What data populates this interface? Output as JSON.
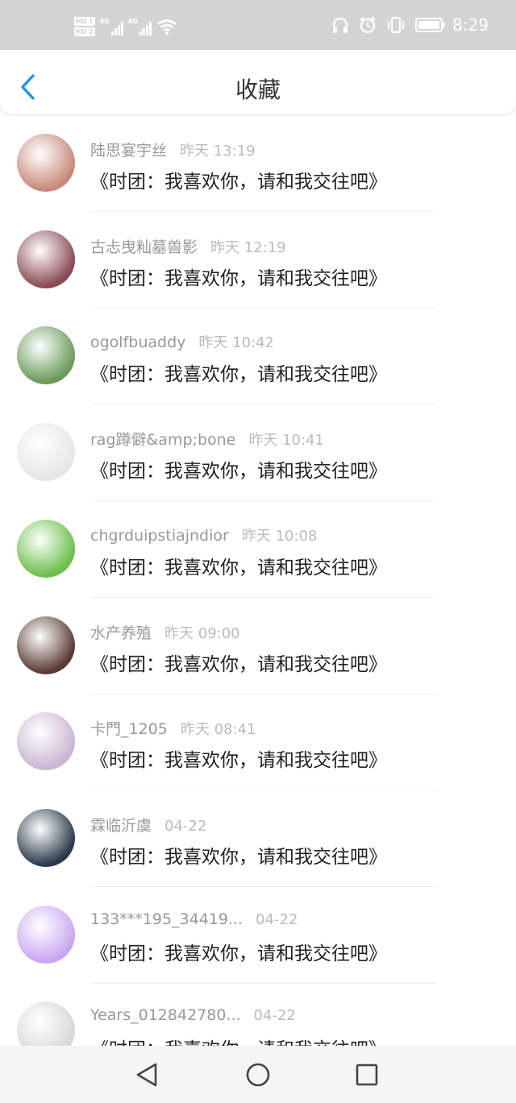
{
  "status_bar": {
    "time": "8:29",
    "sim1": "HD 1",
    "sim2": "HD 2",
    "net": "4G"
  },
  "header": {
    "title": "收藏",
    "back_icon": "chevron-left-icon"
  },
  "favorites": [
    {
      "name": "陆思宴宇丝",
      "time": "昨天 13:19",
      "message": "《时团：我喜欢你，请和我交往吧》",
      "avatar_color": "#c78a7a"
    },
    {
      "name": "古忐曳籼墓兽影",
      "time": "昨天 12:19",
      "message": "《时团：我喜欢你，请和我交往吧》",
      "avatar_color": "#8a4a54"
    },
    {
      "name": "ogolfbuaddy",
      "time": "昨天 10:42",
      "message": "《时团：我喜欢你，请和我交往吧》",
      "avatar_color": "#6a9a5a"
    },
    {
      "name": "rag蹲僻&amp;bone",
      "time": "昨天 10:41",
      "message": "《时团：我喜欢你，请和我交往吧》",
      "avatar_color": "#e6e6e6"
    },
    {
      "name": "chgrduipstiajndior",
      "time": "昨天 10:08",
      "message": "《时团：我喜欢你，请和我交往吧》",
      "avatar_color": "#6cbf4a"
    },
    {
      "name": "水产养殖",
      "time": "昨天 09:00",
      "message": "《时团：我喜欢你，请和我交往吧》",
      "avatar_color": "#5a3a32"
    },
    {
      "name": "卡門_1205",
      "time": "昨天 08:41",
      "message": "《时团：我喜欢你，请和我交往吧》",
      "avatar_color": "#c9b6d2"
    },
    {
      "name": "霖临沂虞",
      "time": "04-22",
      "message": "《时团：我喜欢你，请和我交往吧》",
      "avatar_color": "#2a3a4a"
    },
    {
      "name": "133***195_34419...",
      "time": "04-22",
      "message": "《时团：我喜欢你，请和我交往吧》",
      "avatar_color": "#c9a6f2"
    },
    {
      "name": "Years_012842780...",
      "time": "04-22",
      "message": "《时团：我喜欢你，请和我交往吧》",
      "avatar_color": "#d8d8d8"
    }
  ],
  "nav_bar": {
    "back": "triangle-back-icon",
    "home": "circle-home-icon",
    "recents": "square-recents-icon"
  }
}
